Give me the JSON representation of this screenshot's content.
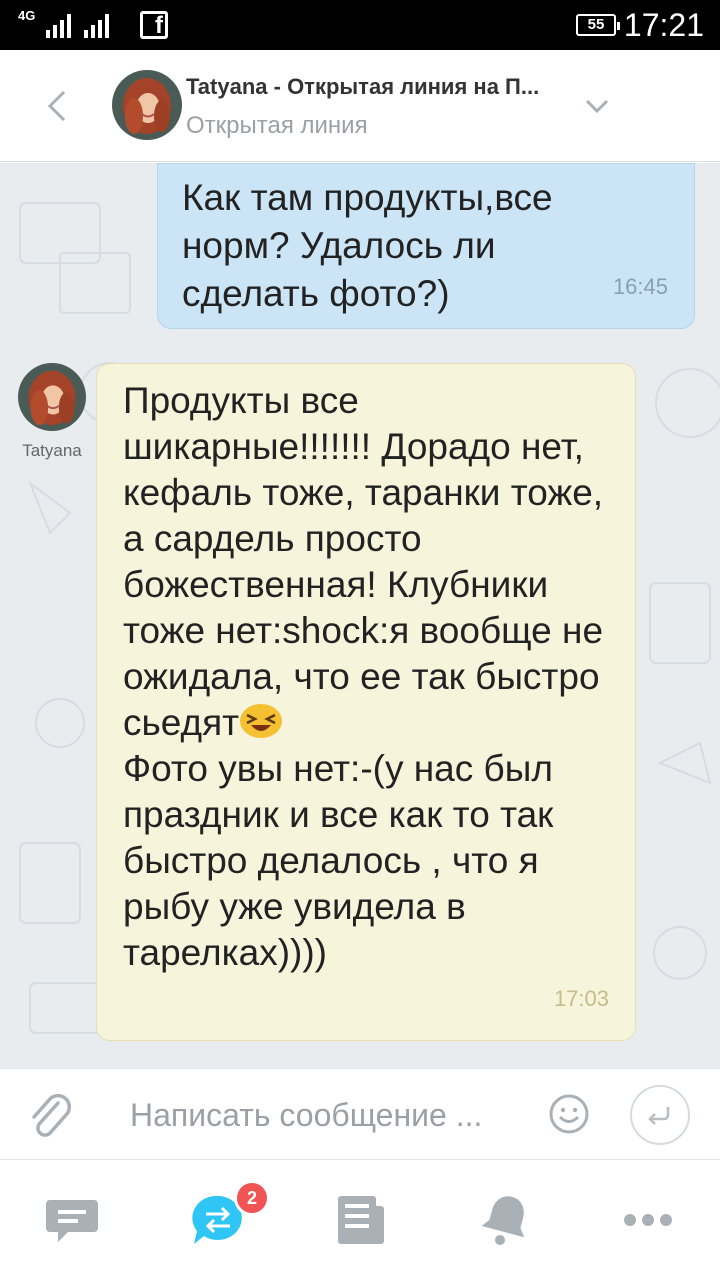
{
  "status_bar": {
    "network": "4G",
    "battery": "55",
    "time": "17:21"
  },
  "header": {
    "title": "Tatyana - Открытая линия на П...",
    "subtitle": "Открытая линия",
    "back_icon": "chevron-left-icon",
    "menu_icon": "chevron-down-icon"
  },
  "messages": [
    {
      "direction": "outgoing",
      "text": "Как там продукты,все норм? Удалось ли сделать фото?)",
      "time": "16:45"
    },
    {
      "direction": "incoming",
      "sender": "Tatyana",
      "text_part1": "Продукты все шикарные!!!!!!! Дорадо нет, кефаль тоже, таранки тоже, а сардель просто божественная! Клубники тоже нет:shock:я вообще не ожидала, что ее так быстро сьедят",
      "emoji": "laughing-face-emoji",
      "text_part2": "\nФото увы нет:-(у нас был праздник и все как то так быстро делалось , что я рыбу уже увидела в тарелках))))",
      "time": "17:03"
    }
  ],
  "composer": {
    "placeholder": "Написать сообщение ...",
    "attach_icon": "paperclip-icon",
    "emoji_icon": "smile-icon",
    "send_icon": "send-arrow-icon"
  },
  "bottom_nav": {
    "items": [
      {
        "icon": "chat-icon"
      },
      {
        "icon": "open-lines-icon",
        "badge": "2"
      },
      {
        "icon": "news-feed-icon"
      },
      {
        "icon": "bell-icon"
      },
      {
        "icon": "more-icon"
      }
    ]
  },
  "colors": {
    "outgoing_bubble": "#cbe5f6",
    "incoming_bubble": "#f7f4dc",
    "accent": "#2fc6f6",
    "badge": "#f05454",
    "chat_background": "#e8ecef"
  }
}
